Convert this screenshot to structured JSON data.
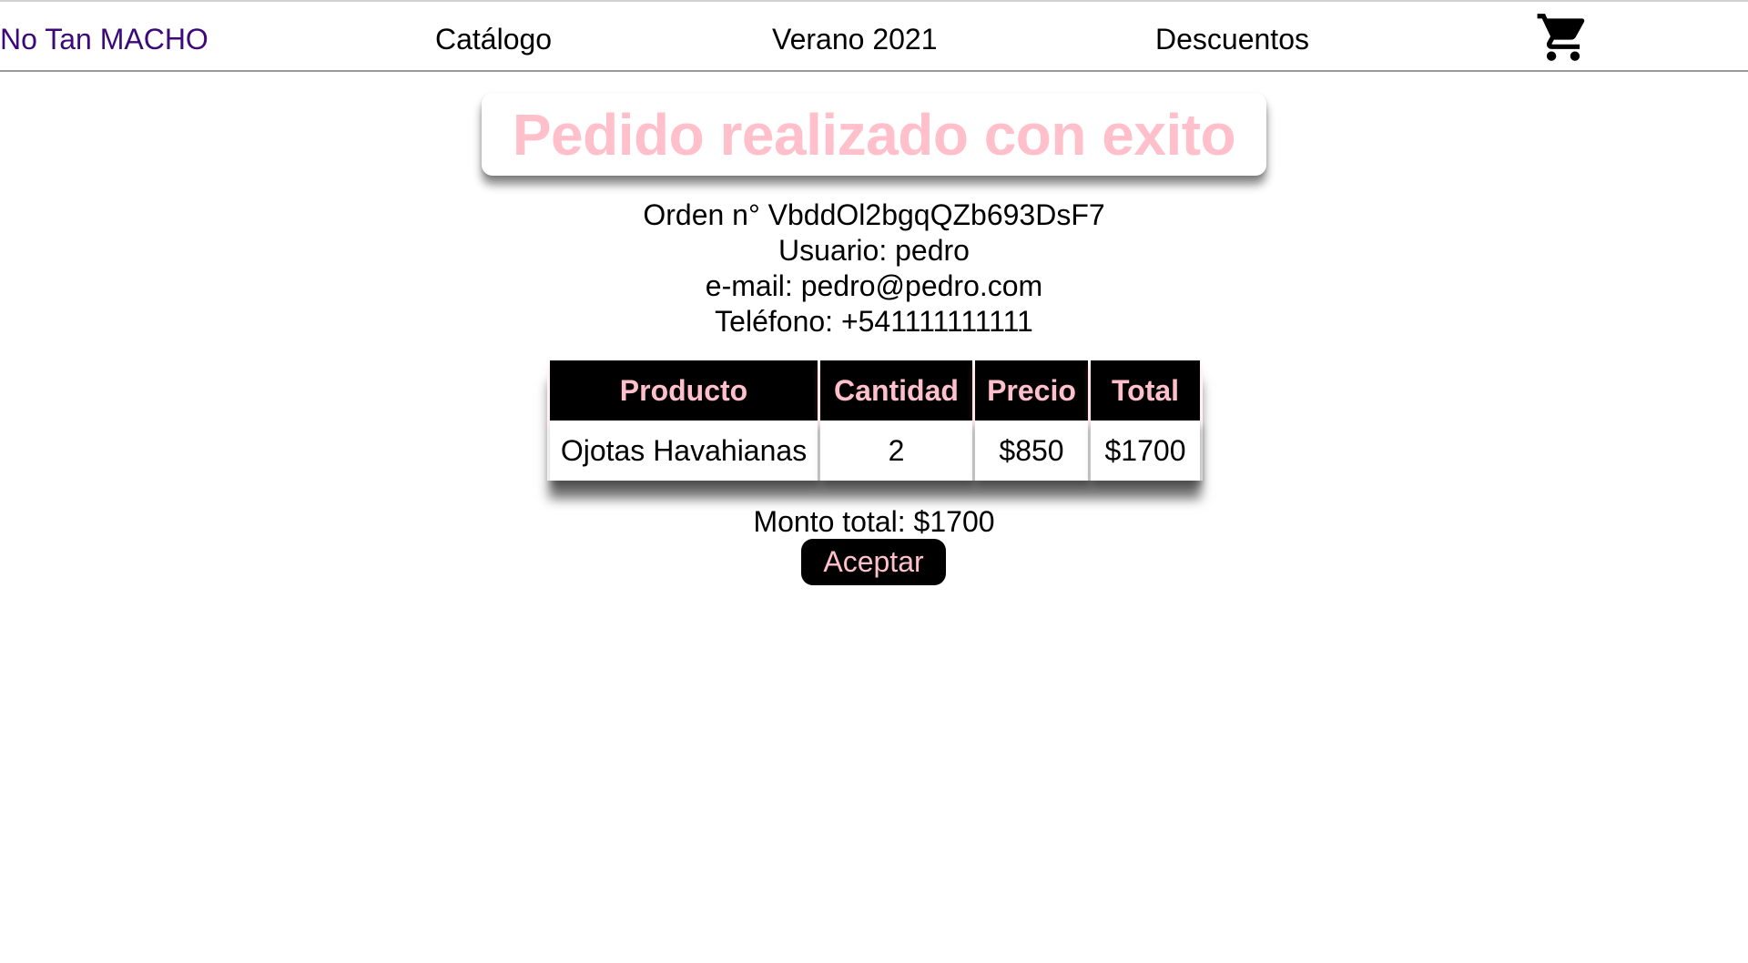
{
  "navbar": {
    "brand": "No Tan MACHO",
    "links": [
      "Catálogo",
      "Verano 2021",
      "Descuentos"
    ],
    "cart_icon": "shopping-cart-icon"
  },
  "confirmation": {
    "title": "Pedido realizado con exito",
    "order": "Orden n° VbddOl2bgqQZb693DsF7",
    "user": "Usuario: pedro",
    "email": "e-mail: pedro@pedro.com",
    "phone": "Teléfono: +541111111111"
  },
  "table": {
    "headers": [
      "Producto",
      "Cantidad",
      "Precio",
      "Total"
    ],
    "rows": [
      [
        "Ojotas Havahianas",
        "2",
        "$850",
        "$1700"
      ]
    ]
  },
  "total": "Monto total: $1700",
  "accept_button": "Aceptar",
  "colors": {
    "brand": "#3b0a78",
    "accent_pink": "#ffc0cb",
    "dark": "#000000"
  }
}
